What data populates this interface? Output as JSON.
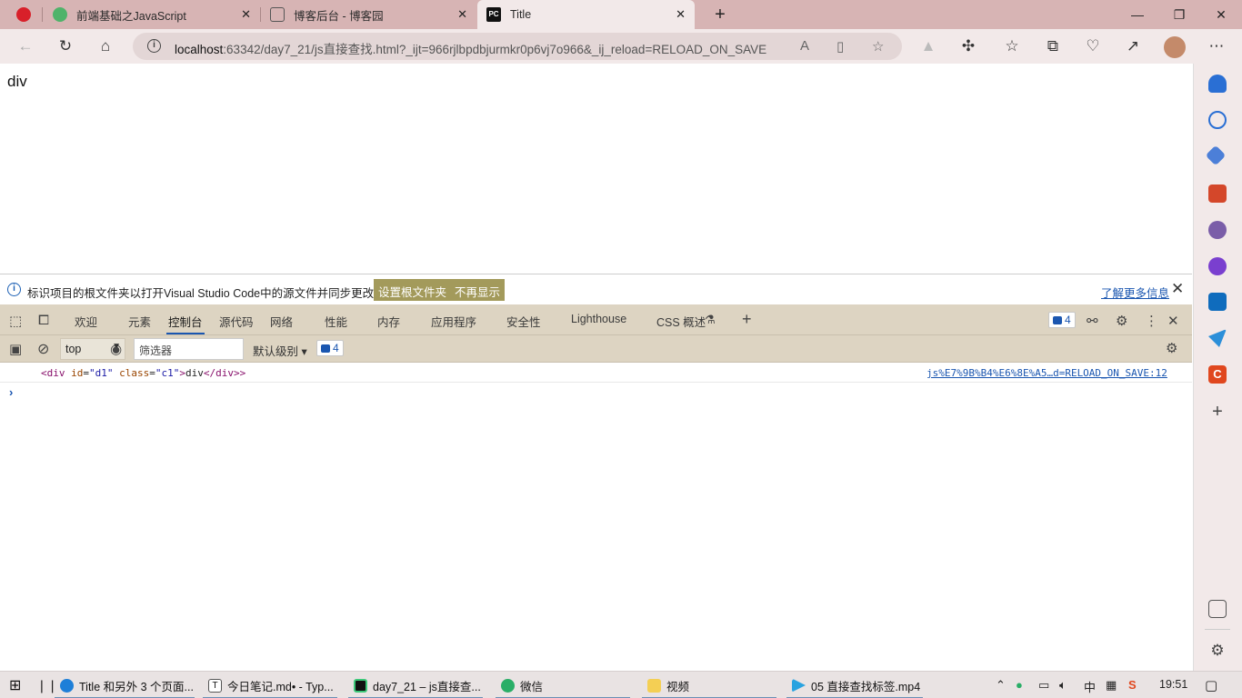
{
  "tabs": [
    {
      "title": "前端基础之JavaScript",
      "icon": "green-leaf-icon"
    },
    {
      "title": "博客后台 - 博客园",
      "icon": "blog-icon"
    },
    {
      "title": "Title",
      "icon": "pycharm-icon",
      "active": true
    }
  ],
  "address": {
    "host": "localhost",
    "path": ":63342/day7_21/js直接查找.html?_ijt=966rjlbpdbjurmkr0p6vj7o966&_ij_reload=RELOAD_ON_SAVE"
  },
  "page": {
    "content_text": "div"
  },
  "infobar": {
    "message": "标识项目的根文件夹以打开Visual Studio Code中的源文件并同步更改。",
    "btn_set_root": "设置根文件夹",
    "btn_dont_show": "不再显示",
    "learn_more": "了解更多信息"
  },
  "devtools": {
    "tabs": [
      "欢迎",
      "元素",
      "控制台",
      "源代码",
      "网络",
      "性能",
      "内存",
      "应用程序",
      "安全性",
      "Lighthouse",
      "CSS 概述"
    ],
    "active_tab": "控制台",
    "issues_count": "4",
    "context": "top",
    "filter_placeholder": "筛选器",
    "levels_label": "默认级别",
    "filter_issues_count": "4"
  },
  "console": {
    "log": {
      "open_tag": "<div",
      "attr1_name": "id",
      "attr1_value": "\"d1\"",
      "attr2_name": "class",
      "attr2_value": "\"c1\"",
      "inner": "div",
      "close_tag": "</div>"
    },
    "source_link": "js%E7%9B%B4%E6%8E%A5…d=RELOAD_ON_SAVE:12",
    "prompt": "›"
  },
  "taskbar": {
    "items": [
      {
        "label": "Title 和另外 3 个页面...",
        "icon": "edge-icon"
      },
      {
        "label": "今日笔记.md• - Typ...",
        "icon": "typora-icon"
      },
      {
        "label": "day7_21 – js直接查...",
        "icon": "pycharm-icon"
      },
      {
        "label": "微信",
        "icon": "wechat-icon"
      },
      {
        "label": "视频",
        "icon": "folder-icon"
      },
      {
        "label": "05 直接查找标签.mp4",
        "icon": "video-player-icon"
      }
    ],
    "clock": "19:51"
  },
  "colors": {
    "titlebar": "#d7b4b4",
    "toolbar": "#f2e9e9",
    "devtools": "#ddd4c2",
    "accent": "#1a56b0"
  }
}
